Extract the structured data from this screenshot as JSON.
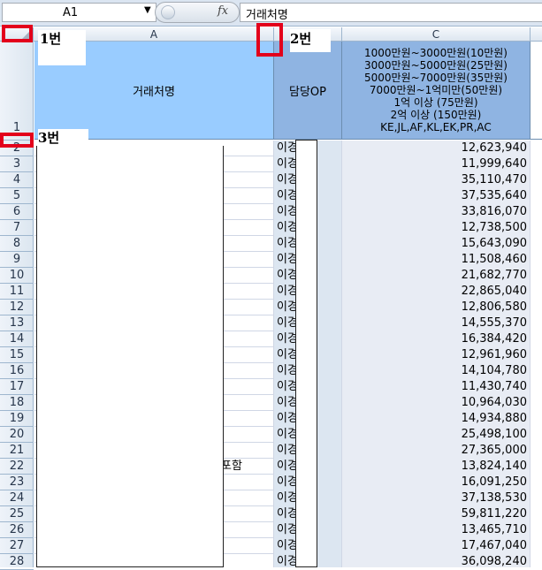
{
  "formula_bar": {
    "cell_ref": "A1",
    "fx_label": "fx",
    "formula_value": "거래처명"
  },
  "column_headers": [
    "A",
    "C"
  ],
  "row_numbers": [
    "1",
    "2",
    "3",
    "4",
    "5",
    "6",
    "7",
    "8",
    "9",
    "10",
    "11",
    "12",
    "13",
    "14",
    "15",
    "16",
    "17",
    "18",
    "19",
    "20",
    "21",
    "22",
    "23",
    "24",
    "25",
    "26",
    "27",
    "28"
  ],
  "header_row": {
    "a": "거래처명",
    "b": "담당OP",
    "c_lines": [
      "1000만원~3000만원(10만원)",
      "3000만원~5000만원(25만원)",
      "5000만원~7000만원(35만원)",
      "7000만원~1억미만(50만원)",
      "1억 이상 (75만원)",
      "2억 이상 (150만원)",
      "KE,JL,AF,KL,EK,PR,AC"
    ]
  },
  "rows": [
    {
      "a_suffix": "",
      "b": "이경",
      "c": "12,623,940"
    },
    {
      "a_suffix": "",
      "b": "이경",
      "c": "11,999,640"
    },
    {
      "a_suffix": "",
      "b": "이경",
      "c": "35,110,470"
    },
    {
      "a_suffix": "",
      "b": "이경",
      "c": "37,535,640"
    },
    {
      "a_suffix": "",
      "b": "이경",
      "c": "33,816,070"
    },
    {
      "a_suffix": "",
      "b": "이경",
      "c": "12,738,500"
    },
    {
      "a_suffix": "",
      "b": "이경",
      "c": "15,643,090"
    },
    {
      "a_suffix": "",
      "b": "이경",
      "c": "11,508,460"
    },
    {
      "a_suffix": "",
      "b": "이경",
      "c": "21,682,770"
    },
    {
      "a_suffix": "",
      "b": "이경",
      "c": "22,865,040"
    },
    {
      "a_suffix": "",
      "b": "이경",
      "c": "12,806,580"
    },
    {
      "a_suffix": "",
      "b": "이경",
      "c": "14,555,370"
    },
    {
      "a_suffix": "",
      "b": "이경",
      "c": "16,384,420"
    },
    {
      "a_suffix": "",
      "b": "이경",
      "c": "12,961,960"
    },
    {
      "a_suffix": "",
      "b": "이경",
      "c": "14,104,780"
    },
    {
      "a_suffix": "",
      "b": "이경",
      "c": "11,430,740"
    },
    {
      "a_suffix": "",
      "b": "이경",
      "c": "10,964,030"
    },
    {
      "a_suffix": "",
      "b": "이경",
      "c": "14,934,880"
    },
    {
      "a_suffix": "",
      "b": "이경",
      "c": "25,498,100"
    },
    {
      "a_suffix": "",
      "b": "이경",
      "c": "27,365,000"
    },
    {
      "a_suffix": "포함",
      "b": "이경",
      "c": "13,824,140"
    },
    {
      "a_suffix": "",
      "b": "이경",
      "c": "16,091,250"
    },
    {
      "a_suffix": "",
      "b": "이경",
      "c": "37,138,530"
    },
    {
      "a_suffix": "",
      "b": "이경",
      "c": "59,811,220"
    },
    {
      "a_suffix": "",
      "b": "이경",
      "c": "13,465,710"
    },
    {
      "a_suffix": "",
      "b": "이경",
      "c": "17,467,040"
    },
    {
      "a_suffix": "",
      "b": "이경",
      "c": "36,098,240"
    }
  ],
  "markers": {
    "m1": "1번",
    "m2": "2번",
    "m3": "3번"
  },
  "colors": {
    "highlight_red": "#e3001b",
    "header_fill": "#99ccff"
  }
}
